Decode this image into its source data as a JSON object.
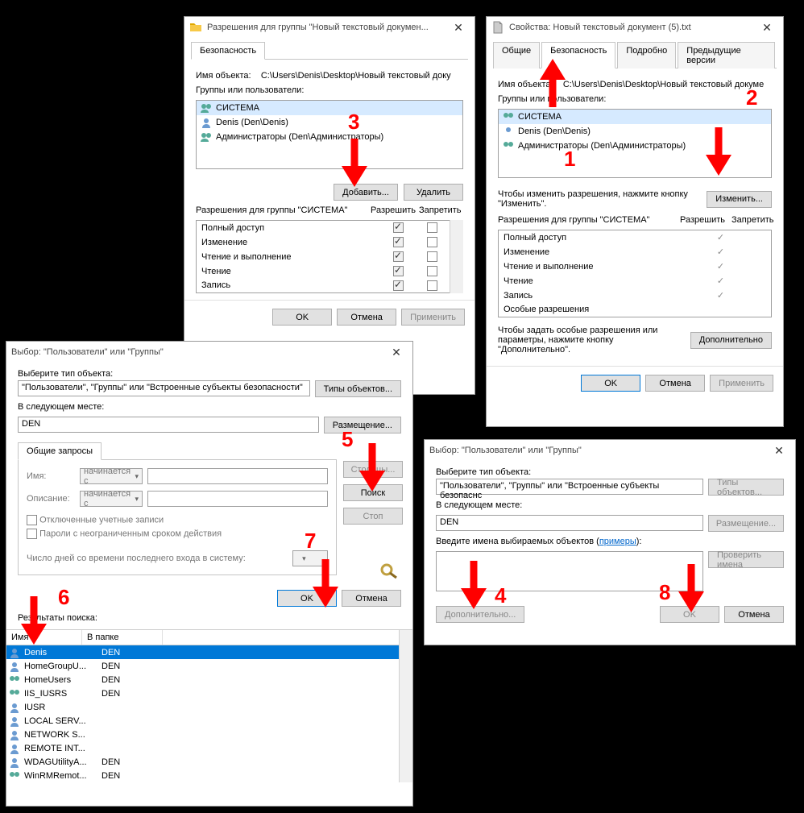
{
  "win_perm": {
    "title": "Разрешения для группы \"Новый текстовый докумен...",
    "tab_security": "Безопасность",
    "obj_label": "Имя объекта:",
    "obj_path": "C:\\Users\\Denis\\Desktop\\Новый текстовый доку",
    "groups_label": "Группы или пользователи:",
    "users": [
      {
        "name": "СИСТЕМА",
        "type": "group"
      },
      {
        "name": "Denis (Den\\Denis)",
        "type": "user"
      },
      {
        "name": "Администраторы (Den\\Администраторы)",
        "type": "group"
      }
    ],
    "btn_add": "Добавить...",
    "btn_remove": "Удалить",
    "perm_header": "Разрешения для группы \"СИСТЕМА\"",
    "col_allow": "Разрешить",
    "col_deny": "Запретить",
    "perms": [
      {
        "name": "Полный доступ",
        "allow": true,
        "deny": false
      },
      {
        "name": "Изменение",
        "allow": true,
        "deny": false
      },
      {
        "name": "Чтение и выполнение",
        "allow": true,
        "deny": false
      },
      {
        "name": "Чтение",
        "allow": true,
        "deny": false
      },
      {
        "name": "Запись",
        "allow": true,
        "deny": false
      }
    ],
    "btn_ok": "OK",
    "btn_cancel": "Отмена",
    "btn_apply": "Применить"
  },
  "win_props": {
    "title": "Свойства: Новый текстовый документ (5).txt",
    "tabs": [
      "Общие",
      "Безопасность",
      "Подробно",
      "Предыдущие версии"
    ],
    "active_tab": 1,
    "obj_label": "Имя объекта:",
    "obj_path": "C:\\Users\\Denis\\Desktop\\Новый текстовый докуме",
    "groups_label": "Группы или пользователи:",
    "users": [
      {
        "name": "СИСТЕМА",
        "type": "group"
      },
      {
        "name": "Denis (Den\\Denis)",
        "type": "user"
      },
      {
        "name": "Администраторы (Den\\Администраторы)",
        "type": "group"
      }
    ],
    "edit_hint": "Чтобы изменить разрешения, нажмите кнопку \"Изменить\".",
    "btn_edit": "Изменить...",
    "perm_header": "Разрешения для группы \"СИСТЕМА\"",
    "col_allow": "Разрешить",
    "col_deny": "Запретить",
    "perms": [
      {
        "name": "Полный доступ",
        "allow": true
      },
      {
        "name": "Изменение",
        "allow": true
      },
      {
        "name": "Чтение и выполнение",
        "allow": true
      },
      {
        "name": "Чтение",
        "allow": true
      },
      {
        "name": "Запись",
        "allow": true
      },
      {
        "name": "Особые разрешения",
        "allow": false
      }
    ],
    "adv_hint": "Чтобы задать особые разрешения или параметры, нажмите кнопку \"Дополнительно\".",
    "btn_adv": "Дополнительно",
    "btn_ok": "OK",
    "btn_cancel": "Отмена",
    "btn_apply": "Применить"
  },
  "win_select_adv": {
    "title": "Выбор: \"Пользователи\" или \"Группы\"",
    "sel_type_label": "Выберите тип объекта:",
    "sel_type_value": "\"Пользователи\", \"Группы\" или \"Встроенные субъекты безопасности\"",
    "btn_types": "Типы объектов...",
    "loc_label": "В следующем месте:",
    "loc_value": "DEN",
    "btn_loc": "Размещение...",
    "common_tab": "Общие запросы",
    "name_label": "Имя:",
    "desc_label": "Описание:",
    "starts_with": "начинается с",
    "chk_disabled": "Отключенные учетные записи",
    "chk_pwd": "Пароли с неограниченным сроком действия",
    "days_label": "Число дней со времени последнего входа в систему:",
    "btn_cols": "Столбцы...",
    "btn_search": "Поиск",
    "btn_stop": "Стоп",
    "btn_ok": "OK",
    "btn_cancel": "Отмена",
    "results_label": "Результаты поиска:",
    "col_name": "Имя",
    "col_folder": "В папке",
    "results": [
      {
        "name": "Denis",
        "folder": "DEN",
        "type": "user",
        "sel": true
      },
      {
        "name": "HomeGroupU...",
        "folder": "DEN",
        "type": "user"
      },
      {
        "name": "HomeUsers",
        "folder": "DEN",
        "type": "group"
      },
      {
        "name": "IIS_IUSRS",
        "folder": "DEN",
        "type": "group"
      },
      {
        "name": "IUSR",
        "folder": "",
        "type": "user"
      },
      {
        "name": "LOCAL SERV...",
        "folder": "",
        "type": "user"
      },
      {
        "name": "NETWORK S...",
        "folder": "",
        "type": "user"
      },
      {
        "name": "REMOTE INT...",
        "folder": "",
        "type": "user"
      },
      {
        "name": "WDAGUtilityA...",
        "folder": "DEN",
        "type": "user"
      },
      {
        "name": "WinRMRemot...",
        "folder": "DEN",
        "type": "group"
      }
    ]
  },
  "win_select_simple": {
    "title": "Выбор: \"Пользователи\" или \"Группы\"",
    "sel_type_label": "Выберите тип объекта:",
    "sel_type_value": "\"Пользователи\", \"Группы\" или \"Встроенные субъекты безопаснс",
    "btn_types": "Типы объектов...",
    "loc_label": "В следующем месте:",
    "loc_value": "DEN",
    "btn_loc": "Размещение...",
    "names_label_pre": "Введите имена выбираемых объектов (",
    "names_link": "примеры",
    "names_label_post": "):",
    "btn_check": "Проверить имена",
    "btn_adv": "Дополнительно...",
    "btn_ok": "OK",
    "btn_cancel": "Отмена"
  },
  "annotations": {
    "1": "1",
    "2": "2",
    "3": "3",
    "4": "4",
    "5": "5",
    "6": "6",
    "7": "7",
    "8": "8"
  }
}
